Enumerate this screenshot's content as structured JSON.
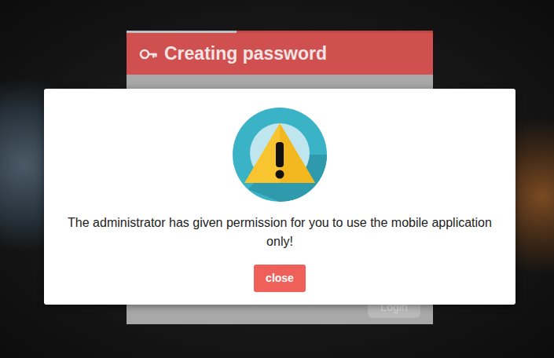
{
  "login_panel": {
    "title": "Creating password",
    "progress": {
      "level": 0.36
    },
    "button": "Login"
  },
  "dialog": {
    "message": "The administrator has given permission for you to use the mobile application only!",
    "button": "close"
  }
}
